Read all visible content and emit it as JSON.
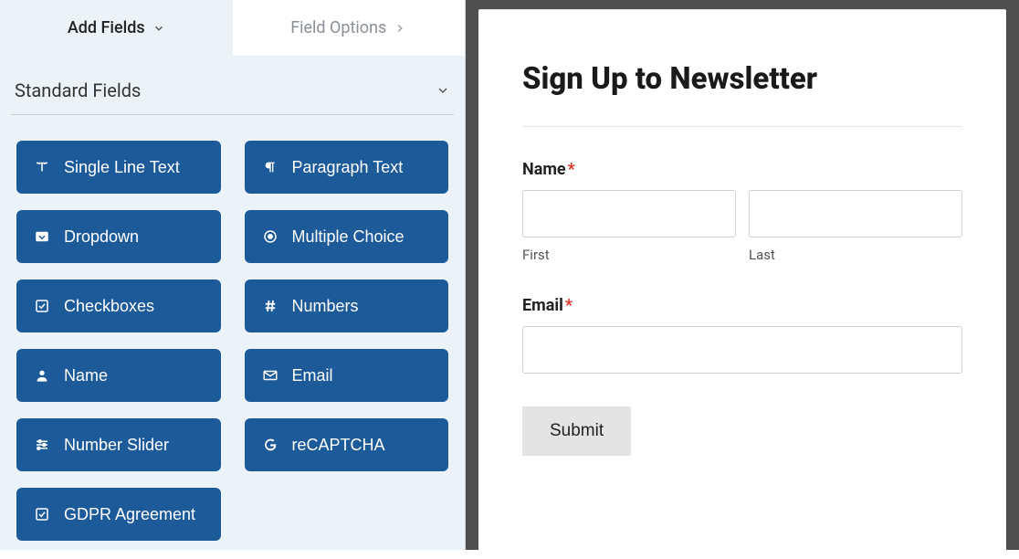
{
  "tabs": {
    "add_fields": "Add Fields",
    "field_options": "Field Options"
  },
  "section": {
    "title": "Standard Fields"
  },
  "fields": [
    {
      "icon": "text-icon",
      "label": "Single Line Text"
    },
    {
      "icon": "paragraph-icon",
      "label": "Paragraph Text"
    },
    {
      "icon": "dropdown-icon",
      "label": "Dropdown"
    },
    {
      "icon": "radio-icon",
      "label": "Multiple Choice"
    },
    {
      "icon": "checkbox-icon",
      "label": "Checkboxes"
    },
    {
      "icon": "hash-icon",
      "label": "Numbers"
    },
    {
      "icon": "person-icon",
      "label": "Name"
    },
    {
      "icon": "envelope-icon",
      "label": "Email"
    },
    {
      "icon": "sliders-icon",
      "label": "Number Slider"
    },
    {
      "icon": "google-icon",
      "label": "reCAPTCHA"
    },
    {
      "icon": "check-square-icon",
      "label": "GDPR Agreement"
    }
  ],
  "preview": {
    "title": "Sign Up to Newsletter",
    "name_label": "Name",
    "first_sub": "First",
    "last_sub": "Last",
    "email_label": "Email",
    "required_mark": "*",
    "submit_label": "Submit"
  }
}
